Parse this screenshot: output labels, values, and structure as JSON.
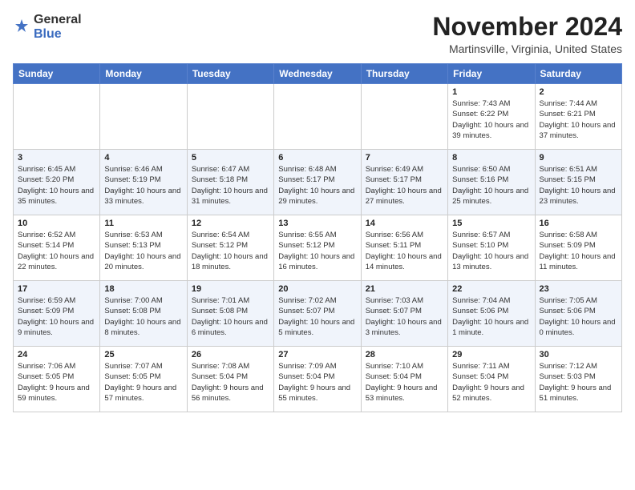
{
  "header": {
    "logo_general": "General",
    "logo_blue": "Blue",
    "month_title": "November 2024",
    "location": "Martinsville, Virginia, United States"
  },
  "weekdays": [
    "Sunday",
    "Monday",
    "Tuesday",
    "Wednesday",
    "Thursday",
    "Friday",
    "Saturday"
  ],
  "weeks": [
    [
      null,
      null,
      null,
      null,
      null,
      {
        "day": "1",
        "sunrise": "Sunrise: 7:43 AM",
        "sunset": "Sunset: 6:22 PM",
        "daylight": "Daylight: 10 hours and 39 minutes."
      },
      {
        "day": "2",
        "sunrise": "Sunrise: 7:44 AM",
        "sunset": "Sunset: 6:21 PM",
        "daylight": "Daylight: 10 hours and 37 minutes."
      }
    ],
    [
      {
        "day": "3",
        "sunrise": "Sunrise: 6:45 AM",
        "sunset": "Sunset: 5:20 PM",
        "daylight": "Daylight: 10 hours and 35 minutes."
      },
      {
        "day": "4",
        "sunrise": "Sunrise: 6:46 AM",
        "sunset": "Sunset: 5:19 PM",
        "daylight": "Daylight: 10 hours and 33 minutes."
      },
      {
        "day": "5",
        "sunrise": "Sunrise: 6:47 AM",
        "sunset": "Sunset: 5:18 PM",
        "daylight": "Daylight: 10 hours and 31 minutes."
      },
      {
        "day": "6",
        "sunrise": "Sunrise: 6:48 AM",
        "sunset": "Sunset: 5:17 PM",
        "daylight": "Daylight: 10 hours and 29 minutes."
      },
      {
        "day": "7",
        "sunrise": "Sunrise: 6:49 AM",
        "sunset": "Sunset: 5:17 PM",
        "daylight": "Daylight: 10 hours and 27 minutes."
      },
      {
        "day": "8",
        "sunrise": "Sunrise: 6:50 AM",
        "sunset": "Sunset: 5:16 PM",
        "daylight": "Daylight: 10 hours and 25 minutes."
      },
      {
        "day": "9",
        "sunrise": "Sunrise: 6:51 AM",
        "sunset": "Sunset: 5:15 PM",
        "daylight": "Daylight: 10 hours and 23 minutes."
      }
    ],
    [
      {
        "day": "10",
        "sunrise": "Sunrise: 6:52 AM",
        "sunset": "Sunset: 5:14 PM",
        "daylight": "Daylight: 10 hours and 22 minutes."
      },
      {
        "day": "11",
        "sunrise": "Sunrise: 6:53 AM",
        "sunset": "Sunset: 5:13 PM",
        "daylight": "Daylight: 10 hours and 20 minutes."
      },
      {
        "day": "12",
        "sunrise": "Sunrise: 6:54 AM",
        "sunset": "Sunset: 5:12 PM",
        "daylight": "Daylight: 10 hours and 18 minutes."
      },
      {
        "day": "13",
        "sunrise": "Sunrise: 6:55 AM",
        "sunset": "Sunset: 5:12 PM",
        "daylight": "Daylight: 10 hours and 16 minutes."
      },
      {
        "day": "14",
        "sunrise": "Sunrise: 6:56 AM",
        "sunset": "Sunset: 5:11 PM",
        "daylight": "Daylight: 10 hours and 14 minutes."
      },
      {
        "day": "15",
        "sunrise": "Sunrise: 6:57 AM",
        "sunset": "Sunset: 5:10 PM",
        "daylight": "Daylight: 10 hours and 13 minutes."
      },
      {
        "day": "16",
        "sunrise": "Sunrise: 6:58 AM",
        "sunset": "Sunset: 5:09 PM",
        "daylight": "Daylight: 10 hours and 11 minutes."
      }
    ],
    [
      {
        "day": "17",
        "sunrise": "Sunrise: 6:59 AM",
        "sunset": "Sunset: 5:09 PM",
        "daylight": "Daylight: 10 hours and 9 minutes."
      },
      {
        "day": "18",
        "sunrise": "Sunrise: 7:00 AM",
        "sunset": "Sunset: 5:08 PM",
        "daylight": "Daylight: 10 hours and 8 minutes."
      },
      {
        "day": "19",
        "sunrise": "Sunrise: 7:01 AM",
        "sunset": "Sunset: 5:08 PM",
        "daylight": "Daylight: 10 hours and 6 minutes."
      },
      {
        "day": "20",
        "sunrise": "Sunrise: 7:02 AM",
        "sunset": "Sunset: 5:07 PM",
        "daylight": "Daylight: 10 hours and 5 minutes."
      },
      {
        "day": "21",
        "sunrise": "Sunrise: 7:03 AM",
        "sunset": "Sunset: 5:07 PM",
        "daylight": "Daylight: 10 hours and 3 minutes."
      },
      {
        "day": "22",
        "sunrise": "Sunrise: 7:04 AM",
        "sunset": "Sunset: 5:06 PM",
        "daylight": "Daylight: 10 hours and 1 minute."
      },
      {
        "day": "23",
        "sunrise": "Sunrise: 7:05 AM",
        "sunset": "Sunset: 5:06 PM",
        "daylight": "Daylight: 10 hours and 0 minutes."
      }
    ],
    [
      {
        "day": "24",
        "sunrise": "Sunrise: 7:06 AM",
        "sunset": "Sunset: 5:05 PM",
        "daylight": "Daylight: 9 hours and 59 minutes."
      },
      {
        "day": "25",
        "sunrise": "Sunrise: 7:07 AM",
        "sunset": "Sunset: 5:05 PM",
        "daylight": "Daylight: 9 hours and 57 minutes."
      },
      {
        "day": "26",
        "sunrise": "Sunrise: 7:08 AM",
        "sunset": "Sunset: 5:04 PM",
        "daylight": "Daylight: 9 hours and 56 minutes."
      },
      {
        "day": "27",
        "sunrise": "Sunrise: 7:09 AM",
        "sunset": "Sunset: 5:04 PM",
        "daylight": "Daylight: 9 hours and 55 minutes."
      },
      {
        "day": "28",
        "sunrise": "Sunrise: 7:10 AM",
        "sunset": "Sunset: 5:04 PM",
        "daylight": "Daylight: 9 hours and 53 minutes."
      },
      {
        "day": "29",
        "sunrise": "Sunrise: 7:11 AM",
        "sunset": "Sunset: 5:04 PM",
        "daylight": "Daylight: 9 hours and 52 minutes."
      },
      {
        "day": "30",
        "sunrise": "Sunrise: 7:12 AM",
        "sunset": "Sunset: 5:03 PM",
        "daylight": "Daylight: 9 hours and 51 minutes."
      }
    ]
  ]
}
